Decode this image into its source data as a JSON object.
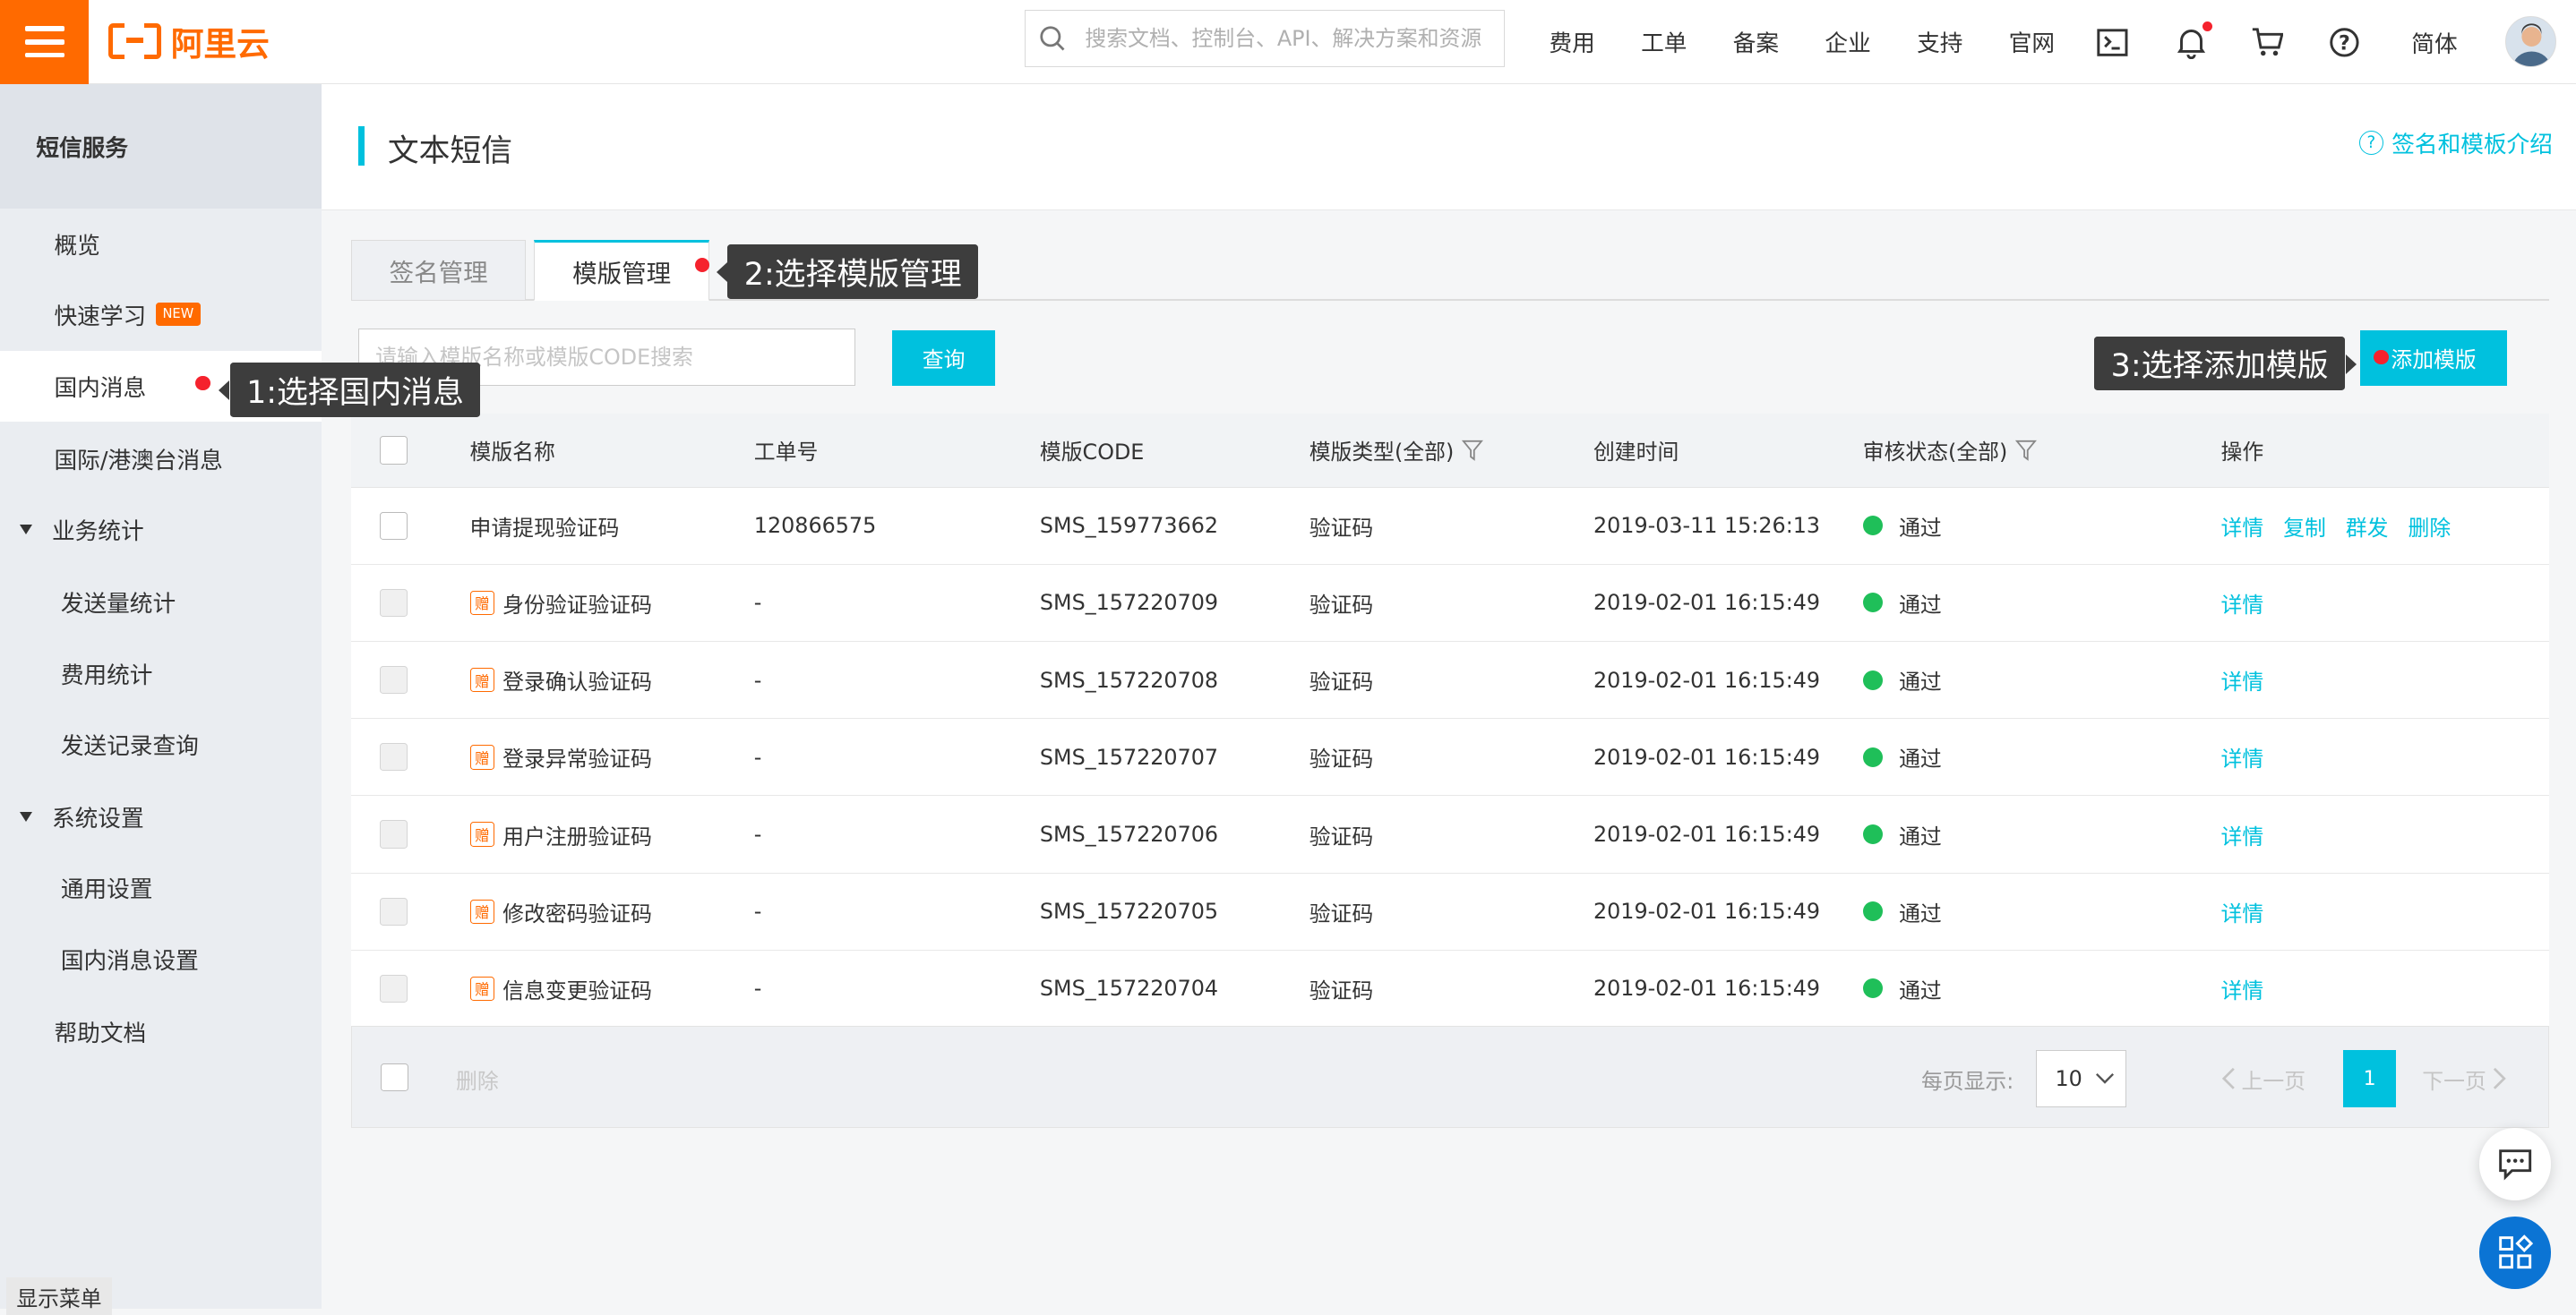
{
  "topbar": {
    "logo_text": "阿里云",
    "search_placeholder": "搜索文档、控制台、API、解决方案和资源",
    "nav": [
      "费用",
      "工单",
      "备案",
      "企业",
      "支持",
      "官网"
    ],
    "lang": "简体",
    "icons": [
      "terminal-icon",
      "bell-icon",
      "cart-icon",
      "help-icon"
    ]
  },
  "sidebar": {
    "title": "短信服务",
    "items": [
      {
        "label": "概览"
      },
      {
        "label": "快速学习",
        "badge": "NEW"
      },
      {
        "label": "国内消息"
      },
      {
        "label": "国际/港澳台消息"
      },
      {
        "label": "业务统计"
      },
      {
        "label": "发送量统计"
      },
      {
        "label": "费用统计"
      },
      {
        "label": "发送记录查询"
      },
      {
        "label": "系统设置"
      },
      {
        "label": "通用设置"
      },
      {
        "label": "国内消息设置"
      },
      {
        "label": "帮助文档"
      }
    ],
    "show_menu": "显示菜单"
  },
  "page": {
    "title": "文本短信",
    "help_link": "签名和模板介绍",
    "tabs": [
      "签名管理",
      "模版管理"
    ],
    "search_placeholder": "请输入模版名称或模版CODE搜索",
    "query_btn": "查询",
    "add_btn": "添加模版"
  },
  "table": {
    "columns": [
      "模版名称",
      "工单号",
      "模版CODE",
      "模版类型(全部)",
      "创建时间",
      "审核状态(全部)",
      "操作"
    ],
    "gift_badge": "赠",
    "rows": [
      {
        "name": "申请提现验证码",
        "ticket": "120866575",
        "code": "SMS_159773662",
        "type": "验证码",
        "created": "2019-03-11 15:26:13",
        "status": "通过",
        "ops": [
          "详情",
          "复制",
          "群发",
          "删除"
        ],
        "gift": false
      },
      {
        "name": "身份验证验证码",
        "ticket": "-",
        "code": "SMS_157220709",
        "type": "验证码",
        "created": "2019-02-01 16:15:49",
        "status": "通过",
        "ops": [
          "详情"
        ],
        "gift": true
      },
      {
        "name": "登录确认验证码",
        "ticket": "-",
        "code": "SMS_157220708",
        "type": "验证码",
        "created": "2019-02-01 16:15:49",
        "status": "通过",
        "ops": [
          "详情"
        ],
        "gift": true
      },
      {
        "name": "登录异常验证码",
        "ticket": "-",
        "code": "SMS_157220707",
        "type": "验证码",
        "created": "2019-02-01 16:15:49",
        "status": "通过",
        "ops": [
          "详情"
        ],
        "gift": true
      },
      {
        "name": "用户注册验证码",
        "ticket": "-",
        "code": "SMS_157220706",
        "type": "验证码",
        "created": "2019-02-01 16:15:49",
        "status": "通过",
        "ops": [
          "详情"
        ],
        "gift": true
      },
      {
        "name": "修改密码验证码",
        "ticket": "-",
        "code": "SMS_157220705",
        "type": "验证码",
        "created": "2019-02-01 16:15:49",
        "status": "通过",
        "ops": [
          "详情"
        ],
        "gift": true
      },
      {
        "name": "信息变更验证码",
        "ticket": "-",
        "code": "SMS_157220704",
        "type": "验证码",
        "created": "2019-02-01 16:15:49",
        "status": "通过",
        "ops": [
          "详情"
        ],
        "gift": true
      }
    ],
    "footer": {
      "delete": "删除",
      "per_page_label": "每页显示:",
      "per_page_value": "10",
      "prev": "上一页",
      "next": "下一页",
      "current_page": "1"
    }
  },
  "annotations": {
    "step1": "1:选择国内消息",
    "step2": "2:选择模版管理",
    "step3": "3:选择添加模版"
  },
  "colors": {
    "accent": "#00c1de",
    "brand": "#ff6a00",
    "status_ok": "#1fbf59",
    "annotation_dot": "#f5222d"
  }
}
